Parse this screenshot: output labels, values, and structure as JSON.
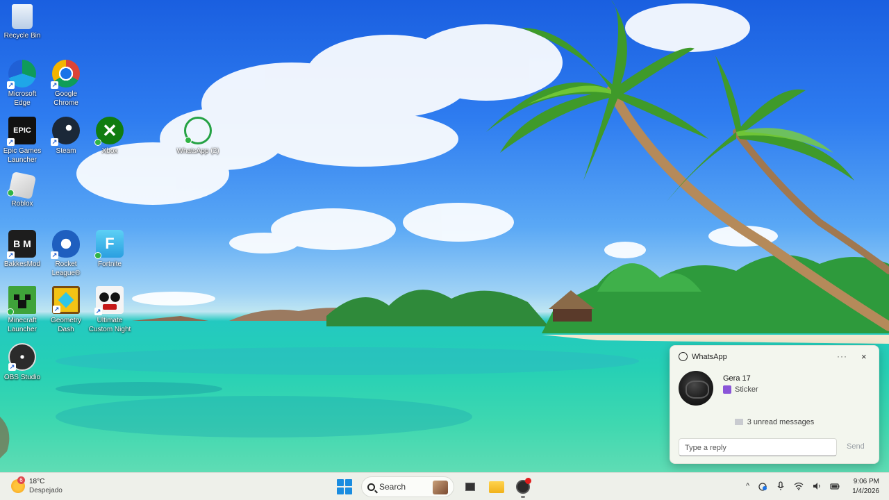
{
  "desktop": {
    "icons": [
      {
        "label": "Recycle Bin",
        "icon": "recycle-bin-icon"
      },
      {
        "label": "Microsoft Edge",
        "icon": "edge-icon"
      },
      {
        "label": "Google Chrome",
        "icon": "chrome-icon"
      },
      {
        "label": "Epic Games Launcher",
        "icon": "epic-games-icon"
      },
      {
        "label": "Steam",
        "icon": "steam-icon"
      },
      {
        "label": "Xbox",
        "icon": "xbox-icon"
      },
      {
        "label": "WhatsApp (2)",
        "icon": "whatsapp-icon"
      },
      {
        "label": "Roblox",
        "icon": "roblox-icon"
      },
      {
        "label": "BakkesMod",
        "icon": "bakkesmod-icon"
      },
      {
        "label": "Rocket League®",
        "icon": "rocket-league-icon"
      },
      {
        "label": "Fortnite",
        "icon": "fortnite-icon"
      },
      {
        "label": "Minecraft Launcher",
        "icon": "minecraft-icon"
      },
      {
        "label": "Geometry Dash",
        "icon": "geometry-dash-icon"
      },
      {
        "label": "Ultimate Custom Night",
        "icon": "ucn-icon"
      },
      {
        "label": "OBS Studio",
        "icon": "obs-icon"
      }
    ]
  },
  "notification": {
    "app": "WhatsApp",
    "more": "···",
    "close": "×",
    "sender": "Gera 17",
    "message": "Sticker",
    "unread": "3 unread messages",
    "reply_placeholder": "Type a reply",
    "send": "Send"
  },
  "taskbar": {
    "weather_temp": "18°C",
    "weather_condition": "Despejado",
    "weather_badge": "6",
    "search_label": "Search",
    "time": "9:06 PM",
    "date": "1/4/2026",
    "tray_chevron": "^"
  }
}
